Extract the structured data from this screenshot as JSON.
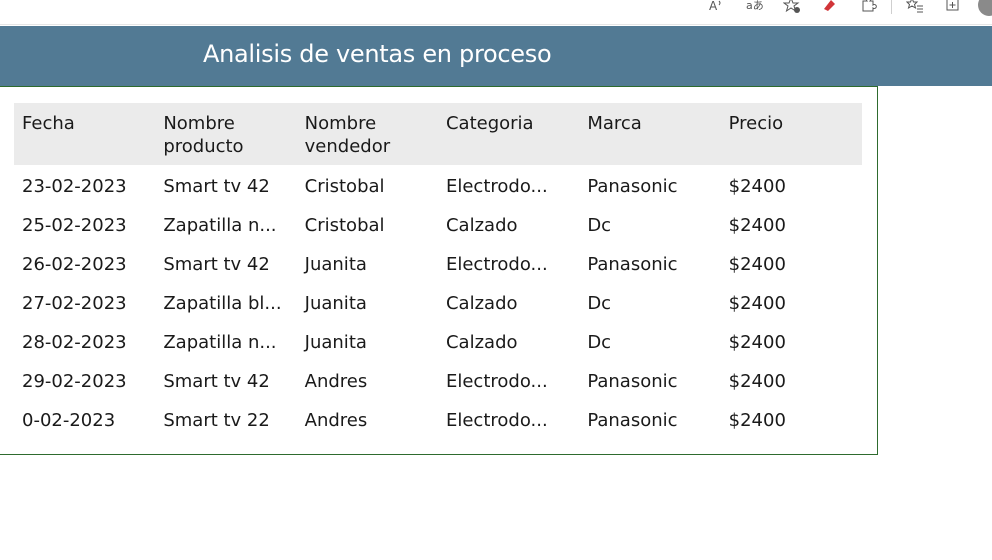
{
  "browser": {
    "icons": [
      "read-aloud-icon",
      "translate-icon",
      "favorite-add-icon",
      "extension-icon",
      "puzzle-icon",
      "favorites-icon",
      "collections-icon",
      "profile-icon"
    ]
  },
  "header": {
    "title": "Analisis de ventas en proceso"
  },
  "table": {
    "columns": [
      "Fecha",
      "Nombre producto",
      "Nombre vendedor",
      "Categoria",
      "Marca",
      "Precio"
    ],
    "rows": [
      [
        "23-02-2023",
        "Smart tv 42",
        "Cristobal",
        "Electrodo...",
        "Panasonic",
        "$2400"
      ],
      [
        "25-02-2023",
        "Zapatilla n...",
        "Cristobal",
        "Calzado",
        "Dc",
        "$2400"
      ],
      [
        "26-02-2023",
        "Smart tv 42",
        "Juanita",
        "Electrodo...",
        "Panasonic",
        "$2400"
      ],
      [
        "27-02-2023",
        "Zapatilla bl...",
        "Juanita",
        "Calzado",
        "Dc",
        "$2400"
      ],
      [
        "28-02-2023",
        "Zapatilla n...",
        "Juanita",
        "Calzado",
        "Dc",
        "$2400"
      ],
      [
        "29-02-2023",
        "Smart tv 42",
        "Andres",
        "Electrodo...",
        "Panasonic",
        "$2400"
      ],
      [
        "0-02-2023",
        "Smart tv 22",
        "Andres",
        "Electrodo...",
        "Panasonic",
        "$2400"
      ]
    ]
  },
  "colors": {
    "banner": "#527a94",
    "panel_border": "#2e6b2e",
    "header_row": "#ebebeb"
  }
}
